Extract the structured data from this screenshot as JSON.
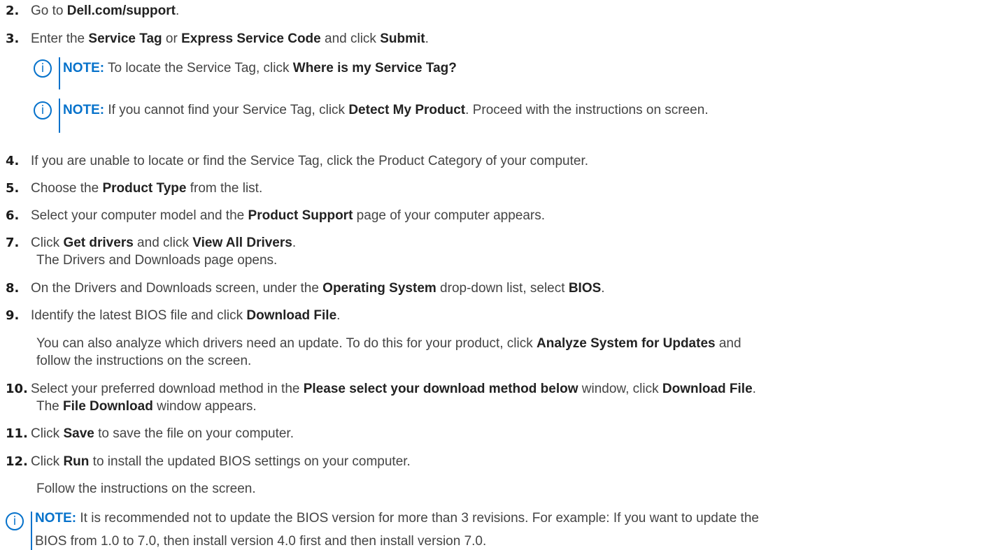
{
  "colors": {
    "accent": "#0672CB",
    "text": "#444444",
    "number": "#1a1a1a"
  },
  "icons": {
    "note": "info-circle-icon",
    "glyph": "i"
  },
  "steps": [
    {
      "num": "2.",
      "parts": [
        {
          "t": "Go to "
        },
        {
          "b": "Dell.com/support"
        },
        {
          "t": "."
        }
      ]
    },
    {
      "num": "3.",
      "parts": [
        {
          "t": "Enter the "
        },
        {
          "b": "Service Tag"
        },
        {
          "t": " or "
        },
        {
          "b": "Express Service Code"
        },
        {
          "t": " and click "
        },
        {
          "b": "Submit"
        },
        {
          "t": "."
        }
      ]
    },
    {
      "num": "4.",
      "parts": [
        {
          "t": "If you are unable to locate or find the Service Tag, click the Product Category of your computer."
        }
      ]
    },
    {
      "num": "5.",
      "parts": [
        {
          "t": "Choose the "
        },
        {
          "b": "Product Type"
        },
        {
          "t": " from the list."
        }
      ]
    },
    {
      "num": "6.",
      "parts": [
        {
          "t": "Select your computer model and the "
        },
        {
          "b": "Product Support"
        },
        {
          "t": " page of your computer appears."
        }
      ]
    },
    {
      "num": "7.",
      "parts": [
        {
          "t": "Click "
        },
        {
          "b": "Get drivers"
        },
        {
          "t": " and click "
        },
        {
          "b": "View All Drivers"
        },
        {
          "t": "."
        }
      ]
    },
    {
      "num": "8.",
      "parts": [
        {
          "t": "On the Drivers and Downloads screen, under the "
        },
        {
          "b": "Operating System"
        },
        {
          "t": " drop-down list, select "
        },
        {
          "b": "BIOS"
        },
        {
          "t": "."
        }
      ]
    },
    {
      "num": "9.",
      "parts": [
        {
          "t": "Identify the latest BIOS file and click "
        },
        {
          "b": "Download File"
        },
        {
          "t": "."
        }
      ]
    },
    {
      "num": "10.",
      "parts": [
        {
          "t": "Select your preferred download method in the "
        },
        {
          "b": "Please select your download method below"
        },
        {
          "t": " window, click "
        },
        {
          "b": "Download File"
        },
        {
          "t": "."
        }
      ]
    },
    {
      "num": "11.",
      "parts": [
        {
          "t": "Click "
        },
        {
          "b": "Save"
        },
        {
          "t": " to save the file on your computer."
        }
      ]
    },
    {
      "num": "12.",
      "parts": [
        {
          "t": "Click "
        },
        {
          "b": "Run"
        },
        {
          "t": " to install the updated BIOS settings on your computer."
        }
      ]
    }
  ],
  "step7_result": "The Drivers and Downloads page opens.",
  "step9_info": [
    [
      {
        "t": "You can also analyze which drivers need an update. To do this for your product, click "
      },
      {
        "b": "Analyze System for Updates"
      },
      {
        "t": " and"
      }
    ],
    [
      {
        "t": "follow the instructions on the screen."
      }
    ]
  ],
  "step10_result": [
    {
      "t": "The "
    },
    {
      "b": "File Download"
    },
    {
      "t": " window appears."
    }
  ],
  "step12_result": "Follow the instructions on the screen.",
  "notes": [
    {
      "label": "NOTE:",
      "lines": [
        [
          {
            "t": " To locate the Service Tag, click "
          },
          {
            "b": "Where is my Service Tag?"
          }
        ]
      ]
    },
    {
      "label": "NOTE:",
      "lines": [
        [
          {
            "t": " If you cannot find your Service Tag, click "
          },
          {
            "b": "Detect My Product"
          },
          {
            "t": ". Proceed with the instructions on screen."
          }
        ]
      ]
    },
    {
      "label": "NOTE:",
      "lines": [
        [
          {
            "t": " It is recommended not to update the BIOS version for more than 3 revisions. For example: If you want to update the"
          }
        ],
        [
          {
            "t": "BIOS from 1.0 to 7.0, then install version 4.0 first and then install version 7.0."
          }
        ]
      ]
    }
  ]
}
